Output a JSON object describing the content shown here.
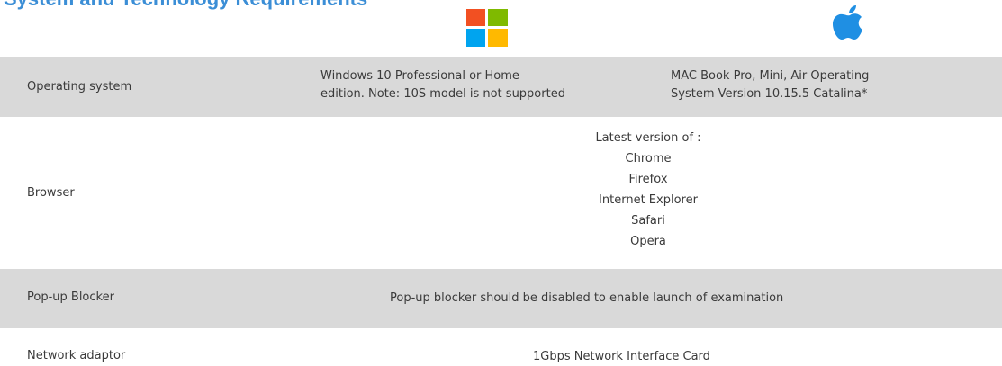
{
  "header": {
    "title": "System and Technology Requirements",
    "windows_logo_icon": "windows-logo-icon",
    "apple_logo_icon": "apple-logo-icon"
  },
  "colors": {
    "title": "#3b8ed6",
    "row_shade": "#d9d9d9",
    "windows_red": "#f25022",
    "windows_green": "#7fba00",
    "windows_blue": "#00a4ef",
    "windows_yellow": "#ffb900",
    "apple_blue": "#1f8fe3"
  },
  "rows": {
    "os": {
      "label": "Operating system",
      "windows_line1": "Windows 10 Professional or Home",
      "windows_line2": "edition. Note: 10S model is not supported",
      "mac_line1": "MAC Book Pro, Mini, Air Operating",
      "mac_line2": "System Version 10.15.5 Catalina*"
    },
    "browser": {
      "label": "Browser",
      "intro": "Latest version of :",
      "items": [
        "Chrome",
        "Firefox",
        "Internet Explorer",
        "Safari",
        "Opera"
      ]
    },
    "popup": {
      "label": "Pop-up Blocker",
      "value": "Pop-up blocker should be disabled to enable launch of examination"
    },
    "network": {
      "label": "Network adaptor",
      "value": "1Gbps Network Interface Card"
    }
  }
}
